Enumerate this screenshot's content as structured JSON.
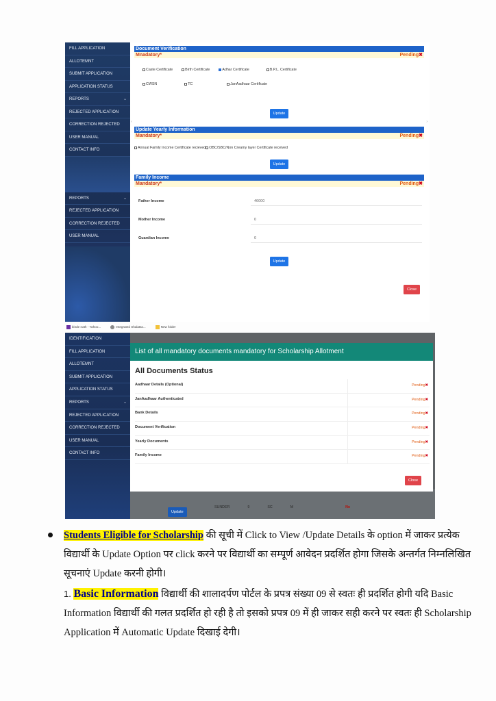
{
  "top_screenshot": {
    "sidebar_top": [
      "FILL APPLICATION",
      "ALLOTEMNT",
      "SUBMIT APPLICATION",
      "APPLICATION STATUS",
      "REPORTS",
      "REJECTED APPLICATION",
      "CORRECTION REJECTED",
      "USER MANUAL",
      "CONTACT INFO"
    ],
    "sidebar_bottom": [
      "REPORTS",
      "REJECTED APPLICATION",
      "CORRECTION REJECTED",
      "USER MANUAL",
      "CONTACT INFO"
    ],
    "document_verification": {
      "title": "Document Verification",
      "mandatory": "Mnadatory*",
      "status": "Pending",
      "row1": [
        {
          "label": "Caste Certificate",
          "checked": false
        },
        {
          "label": "Birth Certificate",
          "checked": false
        },
        {
          "label": "Adhar Certificate",
          "checked": true
        },
        {
          "label": "B.P.L. Certificate",
          "checked": false
        }
      ],
      "row2": [
        {
          "label": "CWSN",
          "checked": false
        },
        {
          "label": "TC",
          "checked": false
        },
        {
          "label": "JanAadhaar Certificate",
          "checked": false
        }
      ],
      "update": "Update"
    },
    "yearly": {
      "title": "Update Yearly Information",
      "mandatory": "Mandatory*",
      "status": "Pending",
      "checkbox_text": "Annual Family Income Certificate recieved",
      "checkbox_text2": "OBC/SBC/Non Creamy layer Certificate received",
      "update": "Update"
    },
    "family_income": {
      "title": "Family Income",
      "mandatory": "Mandatory*",
      "status": "Pending",
      "rows": [
        {
          "label": "Father Income",
          "value": "46000"
        },
        {
          "label": "Mother Income",
          "value": "0"
        },
        {
          "label": "Guardian Income",
          "value": "0"
        }
      ],
      "update": "Update",
      "close": "Close"
    }
  },
  "taskbar": [
    "binde nath - Yahoo...",
    "Integrated ShalaDa...",
    "New folder"
  ],
  "bottom_screenshot": {
    "sidebar": [
      "IDENTIFICATION",
      "FILL APPLICATION",
      "ALLOTEMNT",
      "SUBMIT APPLICATION",
      "APPLICATION STATUS",
      "REPORTS",
      "REJECTED APPLICATION",
      "CORRECTION REJECTED",
      "USER MANUAL",
      "CONTACT INFO"
    ],
    "modal": {
      "header": "List of all mandatory documents mandatory for Scholarship Allotment",
      "title": "All Documents Status",
      "rows": [
        {
          "name": "Aadhaar Details (Optional)",
          "status": "Pending"
        },
        {
          "name": "JanAadhaar Authenticated",
          "status": "Pending"
        },
        {
          "name": "Bank Details",
          "status": "Pending"
        },
        {
          "name": "Document Verification",
          "status": "Pending"
        },
        {
          "name": "Yearly Documents",
          "status": "Pending"
        },
        {
          "name": "Family Income",
          "status": "Pending"
        }
      ],
      "close": "Close"
    },
    "background_row": {
      "update": "Update",
      "name": "SUNDER",
      "class": "9",
      "category": "SC",
      "gender": "M",
      "flag": "No"
    }
  },
  "text": {
    "p1_highlight": "Students Eligible for  Scholarship",
    "p1_rest": " की सूची में  Click to View /Update Details के option में जाकर प्रत्येक विद्यार्थी के Update Option पर click करने पर विद्यार्थी का सम्पूर्ण आवेदन प्रदर्शित होगा जिसके अन्तर्गत निम्नलिखित सूचनाएं Update करनी होगी।",
    "p2_number": "1.",
    "p2_highlight": "Basic Information",
    "p2_rest": " विद्यार्थी की शालादर्पण पोर्टल के प्रपत्र संख्या 09 से स्वतः ही प्रदर्शित होगी यदि Basic Information विद्यार्थी की गलत प्रदर्शित हो रही है तो इसको प्रपत्र 09 में ही जाकर सही करने पर स्वतः ही Scholarship Application में Automatic Update दिखाई देगी।"
  }
}
